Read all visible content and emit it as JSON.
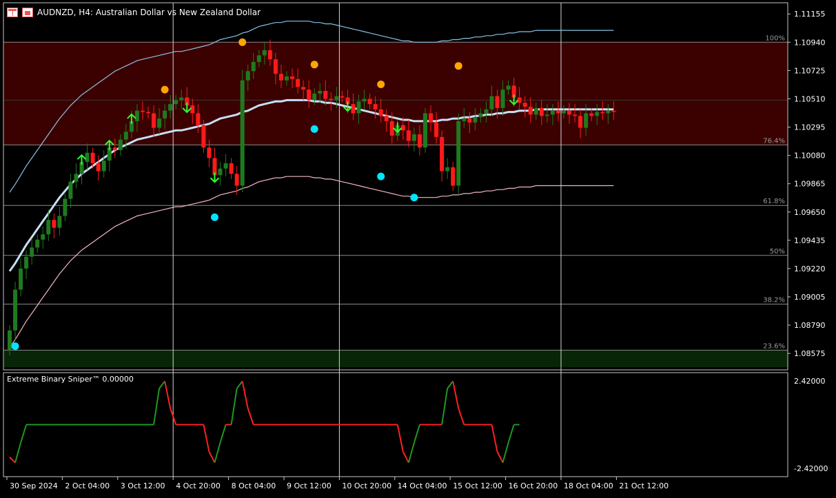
{
  "header": {
    "title": "AUDNZD, H4:  Australian Dollar vs New Zealand Dollar",
    "icons": [
      "window-menu-icon",
      "chart-window-icon"
    ]
  },
  "subwindow": {
    "label": "Extreme Binary Sniper™ 0.00000"
  },
  "colors": {
    "background": "#000000",
    "bull": "#1f7a1f",
    "bear": "#ff1a1a",
    "upper_band": "#87c4e8",
    "lower_band": "#f2b8c0",
    "resistance_zone": "#3b0000",
    "support_zone": "#082508",
    "up_arrow": "#33ff33",
    "down_arrow": "#33ff33",
    "top_dot": "#ffa500",
    "bottom_dot": "#00e5ff",
    "osc_up": "#1f9a1f",
    "osc_down": "#ff2020"
  },
  "chart_data": [
    {
      "type": "candlestick",
      "symbol": "AUDNZD",
      "timeframe": "H4",
      "ylim": [
        1.0845,
        1.1124
      ],
      "y_ticks": [
        "1.11155",
        "1.10940",
        "1.10725",
        "1.10510",
        "1.10295",
        "1.10080",
        "1.09865",
        "1.09650",
        "1.09435",
        "1.09220",
        "1.09005",
        "1.08790",
        "1.08575"
      ],
      "x_ticks": [
        "30 Sep 2024",
        "2 Oct 04:00",
        "3 Oct 12:00",
        "4 Oct 20:00",
        "8 Oct 04:00",
        "9 Oct 12:00",
        "10 Oct 20:00",
        "14 Oct 04:00",
        "15 Oct 12:00",
        "16 Oct 20:00",
        "18 Oct 04:00",
        "21 Oct 12:00"
      ],
      "fib_levels": [
        {
          "label": "100%",
          "value": 1.1094
        },
        {
          "label": "76.4%",
          "value": 1.1016
        },
        {
          "label": "61.8%",
          "value": 1.097
        },
        {
          "label": "50%",
          "value": 1.0932
        },
        {
          "label": "38.2%",
          "value": 1.0895
        },
        {
          "label": "23.6%",
          "value": 1.086
        }
      ],
      "zones": {
        "resistance": [
          1.1016,
          1.1094
        ],
        "support": [
          1.0847,
          1.086
        ]
      },
      "close": [
        1.0875,
        1.0906,
        1.0922,
        1.0931,
        1.0938,
        1.0944,
        1.0948,
        1.0959,
        1.0953,
        1.0962,
        1.0975,
        1.0988,
        1.0994,
        1.1003,
        1.101,
        1.1002,
        1.0996,
        1.1004,
        1.1014,
        1.1012,
        1.102,
        1.1026,
        1.1034,
        1.1042,
        1.1041,
        1.104,
        1.1029,
        1.1036,
        1.1042,
        1.1047,
        1.105,
        1.1052,
        1.1046,
        1.104,
        1.1031,
        1.1014,
        1.1006,
        1.0993,
        1.0998,
        1.1002,
        1.0994,
        1.0985,
        1.1065,
        1.1072,
        1.1079,
        1.1084,
        1.1088,
        1.1081,
        1.107,
        1.1065,
        1.1068,
        1.1066,
        1.106,
        1.1058,
        1.105,
        1.1055,
        1.1057,
        1.1051,
        1.105,
        1.1053,
        1.1052,
        1.1047,
        1.104,
        1.1049,
        1.1051,
        1.1047,
        1.1043,
        1.1038,
        1.1034,
        1.1023,
        1.1031,
        1.1027,
        1.1019,
        1.1024,
        1.1014,
        1.104,
        1.1033,
        1.1022,
        1.0996,
        1.0999,
        1.0985,
        1.1034,
        1.1036,
        1.1033,
        1.1037,
        1.104,
        1.1043,
        1.1053,
        1.1044,
        1.1058,
        1.1061,
        1.1052,
        1.1048,
        1.1045,
        1.1039,
        1.1044,
        1.1038,
        1.1039,
        1.1042,
        1.104,
        1.1042,
        1.1039,
        1.1038,
        1.1029,
        1.104,
        1.1038,
        1.1041,
        1.104,
        1.1042,
        1.1041
      ],
      "ma": [
        1.092,
        1.0926,
        1.0933,
        1.094,
        1.0946,
        1.0952,
        1.0958,
        1.0964,
        1.097,
        1.0976,
        1.0981,
        1.0986,
        1.099,
        1.0994,
        1.0997,
        1.1,
        1.1003,
        1.1006,
        1.1009,
        1.1012,
        1.1014,
        1.1016,
        1.1018,
        1.102,
        1.1021,
        1.1022,
        1.1023,
        1.1024,
        1.1025,
        1.1026,
        1.1027,
        1.1027,
        1.1028,
        1.1029,
        1.103,
        1.1031,
        1.1032,
        1.1034,
        1.1036,
        1.1037,
        1.1038,
        1.1039,
        1.1041,
        1.1042,
        1.1044,
        1.1046,
        1.1047,
        1.1048,
        1.1049,
        1.1049,
        1.105,
        1.105,
        1.105,
        1.105,
        1.105,
        1.1049,
        1.1049,
        1.1048,
        1.1048,
        1.1047,
        1.1046,
        1.1045,
        1.1044,
        1.1043,
        1.1042,
        1.1041,
        1.104,
        1.1039,
        1.1038,
        1.1037,
        1.1036,
        1.1035,
        1.1035,
        1.1034,
        1.1034,
        1.1034,
        1.1034,
        1.1034,
        1.1035,
        1.1035,
        1.1036,
        1.1036,
        1.1037,
        1.1037,
        1.1038,
        1.1038,
        1.1039,
        1.1039,
        1.104,
        1.104,
        1.1041,
        1.1041,
        1.1042,
        1.1042,
        1.1042,
        1.1043,
        1.1043,
        1.1043,
        1.1043,
        1.1043,
        1.1043,
        1.1043,
        1.1043,
        1.1043,
        1.1043,
        1.1043,
        1.1043,
        1.1043,
        1.1043,
        1.1043
      ],
      "up_signals": [
        13,
        18,
        22
      ],
      "down_signals": [
        32,
        37,
        61,
        70,
        91
      ],
      "top_dots": [
        [
          28,
          1.1058
        ],
        [
          42,
          1.1094
        ],
        [
          55,
          1.1077
        ],
        [
          67,
          1.1062
        ],
        [
          81,
          1.1076
        ]
      ],
      "bottom_dots": [
        [
          1,
          1.0863
        ],
        [
          37,
          1.0961
        ],
        [
          55,
          1.1028
        ],
        [
          67,
          1.0992
        ],
        [
          73,
          1.0976
        ]
      ]
    },
    {
      "type": "line",
      "name": "Extreme Binary Sniper™",
      "ylim": [
        -2.42,
        2.42
      ],
      "y_ticks": [
        "2.42000",
        "-2.42000"
      ],
      "values": [
        -1.8,
        -2.1,
        -1.0,
        0.0,
        0.0,
        0.0,
        0.0,
        0.0,
        0.0,
        0.0,
        0.0,
        0.0,
        0.0,
        0.0,
        0.0,
        0.0,
        0.0,
        0.0,
        0.0,
        0.0,
        0.0,
        0.0,
        0.0,
        0.0,
        0.0,
        0.0,
        0.0,
        2.0,
        2.4,
        0.9,
        0.0,
        0.0,
        0.0,
        0.0,
        0.0,
        0.0,
        -1.5,
        -2.1,
        -1.0,
        0.0,
        0.0,
        2.0,
        2.4,
        0.9,
        0.0,
        0.0,
        0.0,
        0.0,
        0.0,
        0.0,
        0.0,
        0.0,
        0.0,
        0.0,
        0.0,
        0.0,
        0.0,
        0.0,
        0.0,
        0.0,
        0.0,
        0.0,
        0.0,
        0.0,
        0.0,
        0.0,
        0.0,
        0.0,
        0.0,
        0.0,
        0.0,
        -1.5,
        -2.1,
        -1.0,
        0.0,
        0.0,
        0.0,
        0.0,
        0.0,
        2.0,
        2.4,
        0.9,
        0.0,
        0.0,
        0.0,
        0.0,
        0.0,
        0.0,
        -1.5,
        -2.1,
        -1.0,
        0.0,
        0.0
      ]
    }
  ]
}
